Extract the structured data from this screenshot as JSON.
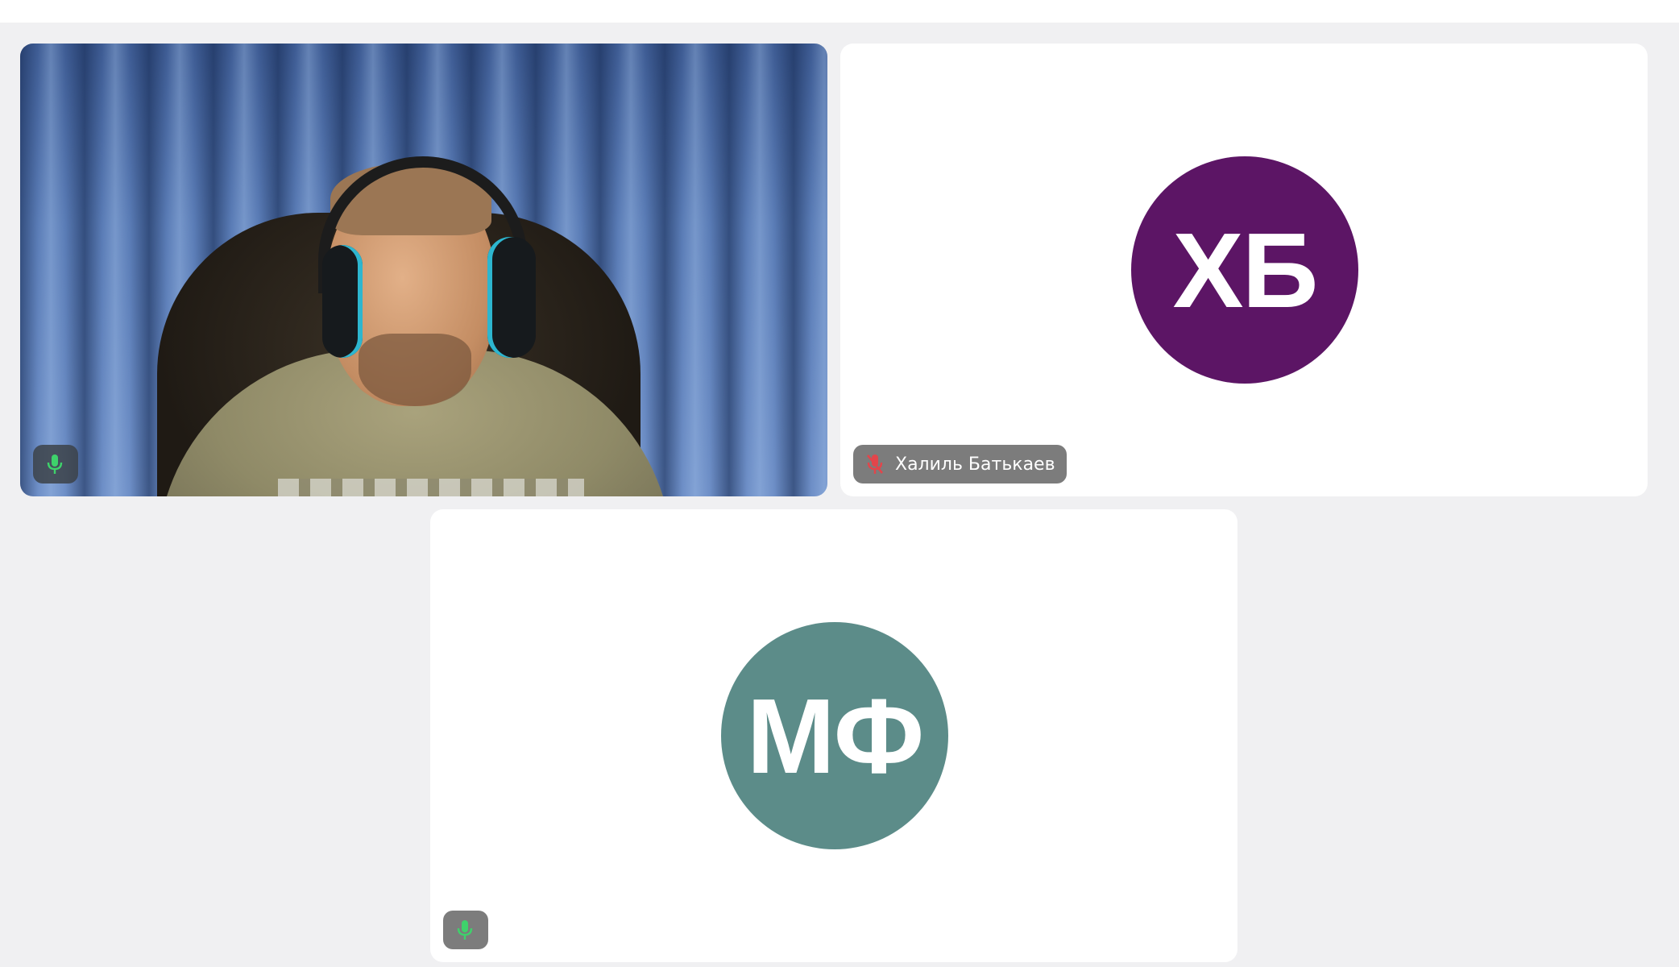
{
  "participants": [
    {
      "id": "p1",
      "type": "video",
      "name": "",
      "mic_status": "on",
      "mic_icon": "mic-icon"
    },
    {
      "id": "p2",
      "type": "avatar",
      "initials": "ХБ",
      "name": "Халиль Батькаев",
      "avatar_color": "#5c1565",
      "mic_status": "muted",
      "mic_icon": "mic-muted-icon"
    },
    {
      "id": "p3",
      "type": "avatar",
      "initials": "МФ",
      "name": "",
      "avatar_color": "#5c8c89",
      "mic_status": "on",
      "mic_icon": "mic-icon"
    }
  ],
  "colors": {
    "background": "#f0f0f2",
    "tile": "#ffffff",
    "mic_on": "#3ed26b",
    "mic_muted": "#e2454b"
  }
}
